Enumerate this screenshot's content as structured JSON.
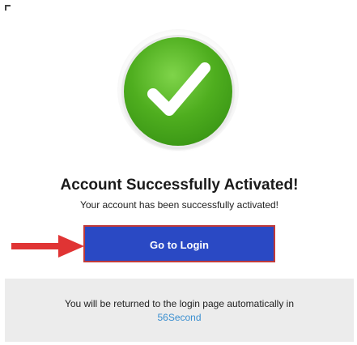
{
  "success": {
    "icon": "checkmark-icon",
    "icon_color": "#4fae1f",
    "title": "Account Successfully Activated!",
    "message": "Your account has been successfully activated!"
  },
  "actions": {
    "login_label": "Go to Login",
    "button_color": "#2a49c4",
    "arrow_icon": "right-arrow-icon",
    "arrow_color": "#e03434"
  },
  "footer": {
    "redirect_text": "You will be returned to the login page automatically in",
    "countdown": "56Second",
    "countdown_color": "#3a8fd0"
  }
}
